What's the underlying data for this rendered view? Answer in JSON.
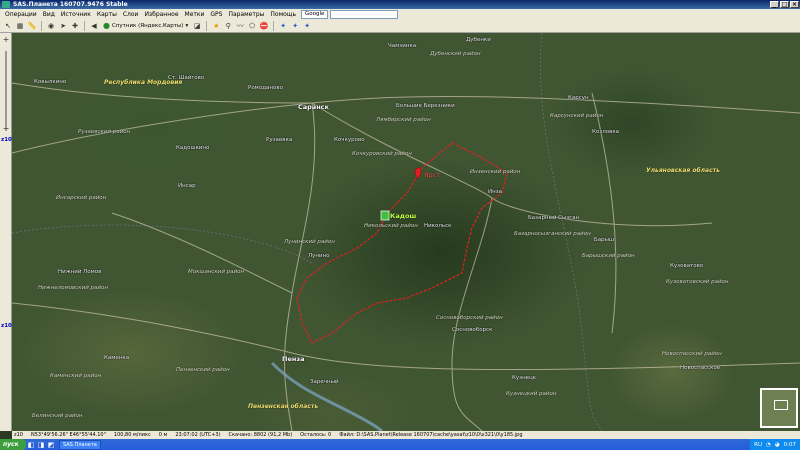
{
  "window": {
    "title": "SAS.Планета 160707.9476 Stable"
  },
  "menu": {
    "items": [
      "Операции",
      "Вид",
      "Источник",
      "Карты",
      "Слои",
      "Избранное",
      "Метки",
      "GPS",
      "Параметры",
      "Помощь"
    ],
    "search_engine": "Google"
  },
  "toolbar": {
    "map_source": "Спутник (Яндекс.Карты)"
  },
  "zoom": {
    "level_label": "z10"
  },
  "map": {
    "regions": {
      "mordovia": "Республика Мордовия",
      "ulyanovsk": "Ульяновская область",
      "penza": "Пензенская область"
    },
    "markers": {
      "red": "Ярст",
      "green": "Кадош"
    },
    "places": {
      "saransk": "Саранск",
      "insar": "Инсар",
      "ruzaevka": "Рузаевка",
      "kadoshkino": "Кадошкино",
      "penza": "Пенза",
      "kamenka": "Каменка",
      "nikolsk": "Никольск",
      "inza": "Инза",
      "kuzovatovo": "Кузоватово",
      "karsun": "Карсун",
      "lunino": "Лунино",
      "sosnovoborsk": "Сосновоборск",
      "kuznetsk": "Кузнецк",
      "bolshoe_berezniki": "Большие Березники",
      "dubenki": "Дубенки",
      "kovylkino": "Ковылкино",
      "bazarny_syzgan": "Базарный Сызган",
      "barysh": "Барыш",
      "novospasskoe": "Новоспасское",
      "zarechny": "Заречный",
      "lomov": "Нижний Ломов",
      "romodanovo": "Ромоданово",
      "kochkurovo": "Кочкурово",
      "chamzinka": "Чамзинка",
      "kozlovka": "Козловка",
      "ruzaevka2": "Ст. Шайгово"
    },
    "districts": {
      "nikolsky": "Никольский район",
      "inzensky": "Инзенский район",
      "sosnovoborsky": "Сосновоборский район",
      "kuzovatovsky": "Кузоватовский район",
      "baryshsky": "Барышский район",
      "kamensky": "Каменский район",
      "penzensky": "Пензенский район",
      "insarsky": "Инсарский район",
      "ruzaevsky": "Рузаевский район",
      "lambirsky": "Лямбирский район",
      "dubensky": "Дубенский район",
      "karsunsky": "Карсунский район",
      "lunninsky": "Лунинский район",
      "kuznetsky": "Кузнецкий район",
      "nizhnelomovsky": "Нижнеломовский район",
      "kochkurovsky": "Кочкуровский район",
      "bazarnosyzgansky": "Базарносызганский район",
      "novospassky": "Новоспасский район",
      "belinsky": "Белинский район",
      "mokshansky": "Мокшанский район"
    }
  },
  "status": {
    "zoom": "z10",
    "coords": "N53°49'56.26\" E46°55'44.10\"",
    "scale": "100,80 м/пикс",
    "distance": "0 м",
    "time": "23:07:02 (UTC+3)",
    "loaded": "Скачано: 8802 (91,2 Mb)",
    "remaining": "Осталось: 0",
    "file": "Файл: D:\\SAS.Planet\\Release 160707\\cache\\yasat\\z10\\0\\x321\\0\\y185.jpg"
  },
  "taskbar": {
    "start": "пуск",
    "task": "SAS.Планета",
    "lang": "RU",
    "clock": "0:07"
  }
}
